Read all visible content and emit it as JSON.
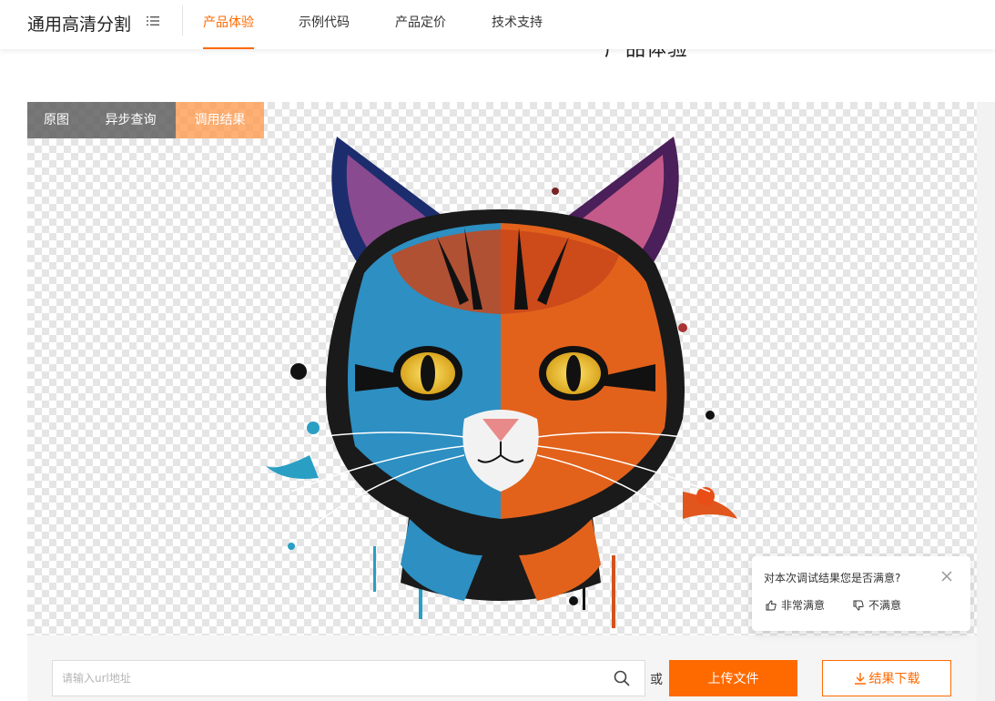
{
  "header": {
    "brand": "通用高清分割",
    "tabs": [
      {
        "label": "产品体验",
        "active": true
      },
      {
        "label": "示例代码",
        "active": false
      },
      {
        "label": "产品定价",
        "active": false
      },
      {
        "label": "技术支持",
        "active": false
      }
    ],
    "section_heading_peek": "产品体验"
  },
  "preview": {
    "view_tabs": [
      {
        "label": "原图",
        "active": false
      },
      {
        "label": "异步查询",
        "active": false
      },
      {
        "label": "调用结果",
        "active": true
      }
    ],
    "image_subject": "cat"
  },
  "feedback": {
    "question": "对本次调试结果您是否满意?",
    "satisfied_label": "非常满意",
    "unsatisfied_label": "不满意"
  },
  "toolbar": {
    "url_placeholder": "请输入url地址",
    "url_value": "",
    "or_text": "或",
    "upload_label": "上传文件",
    "download_label": "结果下载"
  },
  "colors": {
    "accent": "#ff6a00",
    "tab_overlay": "#5a5a5a",
    "tab_overlay_active": "#ff9646"
  },
  "icons": [
    "menu-icon",
    "close-icon",
    "thumbs-up-icon",
    "thumbs-down-icon",
    "search-icon",
    "download-icon"
  ]
}
